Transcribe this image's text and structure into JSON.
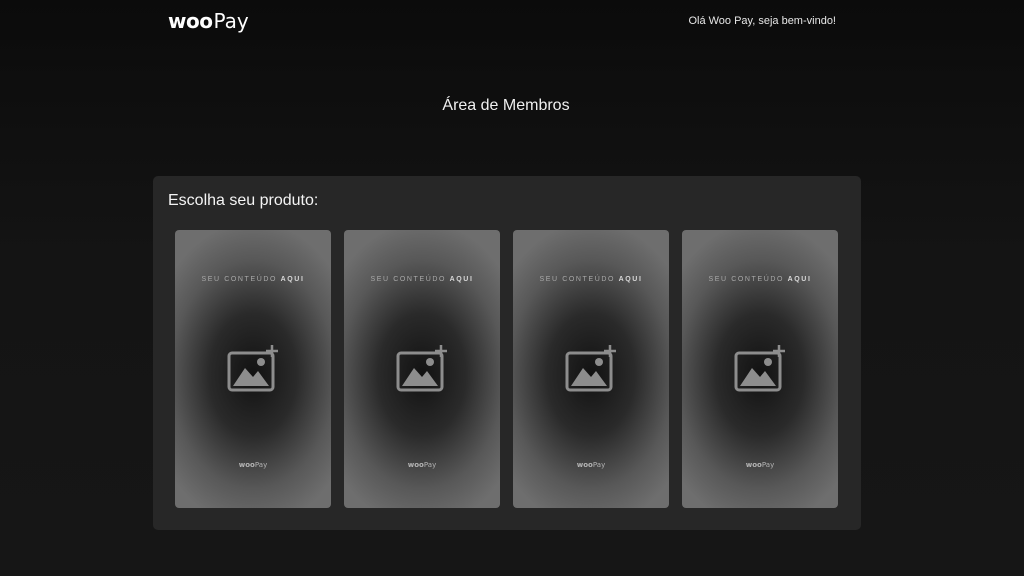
{
  "header": {
    "logo_woo": "woo",
    "logo_pay": "Pay",
    "greeting": "Olá Woo Pay, seja bem-vindo!"
  },
  "page": {
    "title": "Área de Membros"
  },
  "panel": {
    "title": "Escolha seu produto:",
    "cards": [
      {
        "caption_light": "SEU CONTEÚDO",
        "caption_bold": "AQUI",
        "icon": "add-image-icon",
        "logo_woo": "woo",
        "logo_pay": "Pay"
      },
      {
        "caption_light": "SEU CONTEÚDO",
        "caption_bold": "AQUI",
        "icon": "add-image-icon",
        "logo_woo": "woo",
        "logo_pay": "Pay"
      },
      {
        "caption_light": "SEU CONTEÚDO",
        "caption_bold": "AQUI",
        "icon": "add-image-icon",
        "logo_woo": "woo",
        "logo_pay": "Pay"
      },
      {
        "caption_light": "SEU CONTEÚDO",
        "caption_bold": "AQUI",
        "icon": "add-image-icon",
        "logo_woo": "woo",
        "logo_pay": "Pay"
      }
    ]
  },
  "colors": {
    "background": "#121212",
    "panel": "#272727",
    "text": "#f2f2f2"
  }
}
